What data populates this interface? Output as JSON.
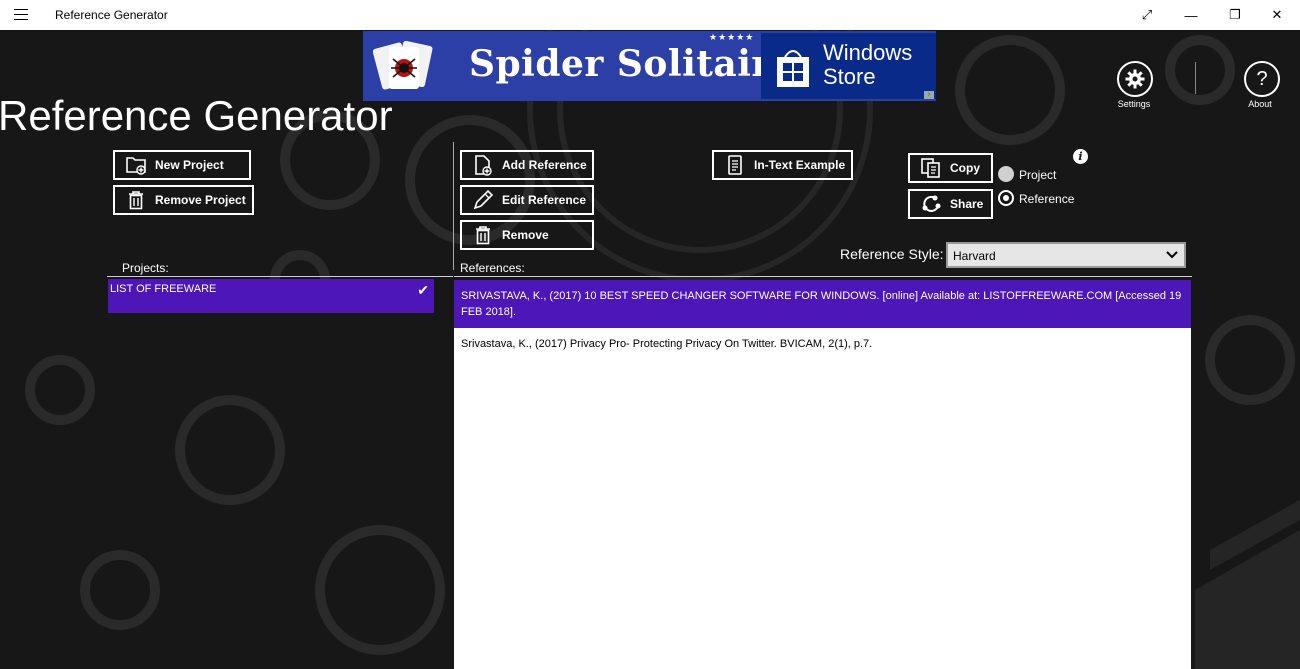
{
  "window": {
    "title": "Reference Generator",
    "controls": {
      "fullscreen": "⤢",
      "minimize": "—",
      "restore": "❐",
      "close": "✕"
    }
  },
  "ad": {
    "title": "Spider Solitaire",
    "stars": "★★★★★",
    "store_line1": "Windows",
    "store_line2": "Store"
  },
  "header": {
    "title": "Reference Generator",
    "settings_label": "Settings",
    "about_label": "About"
  },
  "projects": {
    "new_label": "New Project",
    "remove_label": "Remove Project",
    "heading": "Projects:",
    "items": [
      {
        "name": "LIST OF FREEWARE",
        "selected": true
      }
    ]
  },
  "references": {
    "add_label": "Add Reference",
    "edit_label": "Edit Reference",
    "remove_label": "Remove",
    "heading": "References:",
    "items": [
      {
        "text": "SRIVASTAVA, K., (2017) 10 BEST SPEED CHANGER SOFTWARE FOR WINDOWS. [online] Available at: LISTOFFREEWARE.COM [Accessed 19 FEB 2018].",
        "selected": true
      },
      {
        "text": "Srivastava, K., (2017) Privacy Pro- Protecting Privacy On Twitter. BVICAM, 2(1), p.7.",
        "selected": false
      }
    ]
  },
  "actions": {
    "in_text_label": "In-Text Example",
    "copy_label": "Copy",
    "share_label": "Share",
    "scope_options": [
      {
        "label": "Project",
        "checked": false
      },
      {
        "label": "Reference",
        "checked": true
      }
    ],
    "info_glyph": "i"
  },
  "style": {
    "label": "Reference Style:",
    "selected": "Harvard"
  },
  "colors": {
    "accent": "#4d16b9",
    "background": "#171717",
    "ad_blue": "#2b3fa6"
  }
}
